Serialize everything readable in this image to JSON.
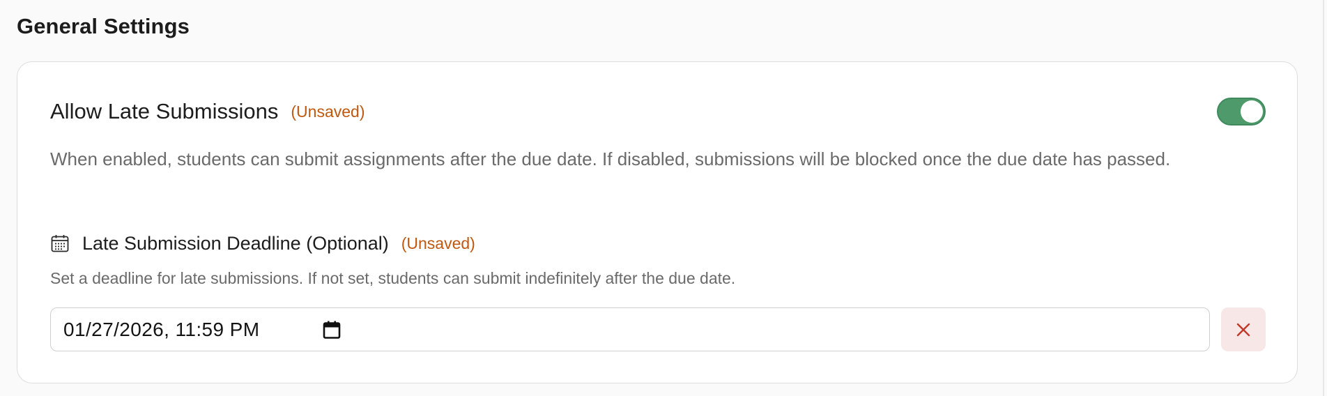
{
  "section": {
    "title": "General Settings"
  },
  "late_submissions": {
    "label": "Allow Late Submissions",
    "status": "(Unsaved)",
    "toggle_on": true,
    "description": "When enabled, students can submit assignments after the due date. If disabled, submissions will be blocked once the due date has passed."
  },
  "deadline": {
    "icon": "calendar-icon",
    "label": "Late Submission Deadline (Optional)",
    "status": "(Unsaved)",
    "description": "Set a deadline for late submissions. If not set, students can submit indefinitely after the due date.",
    "value": "01/27/2026, 11:59 PM",
    "picker_icon": "calendar-picker-icon",
    "clear_icon": "close-icon"
  },
  "colors": {
    "toggle_on": "#4f9a6b",
    "unsaved": "#c0580f",
    "clear_bg": "#f8e7e7",
    "clear_icon": "#c0392b"
  }
}
